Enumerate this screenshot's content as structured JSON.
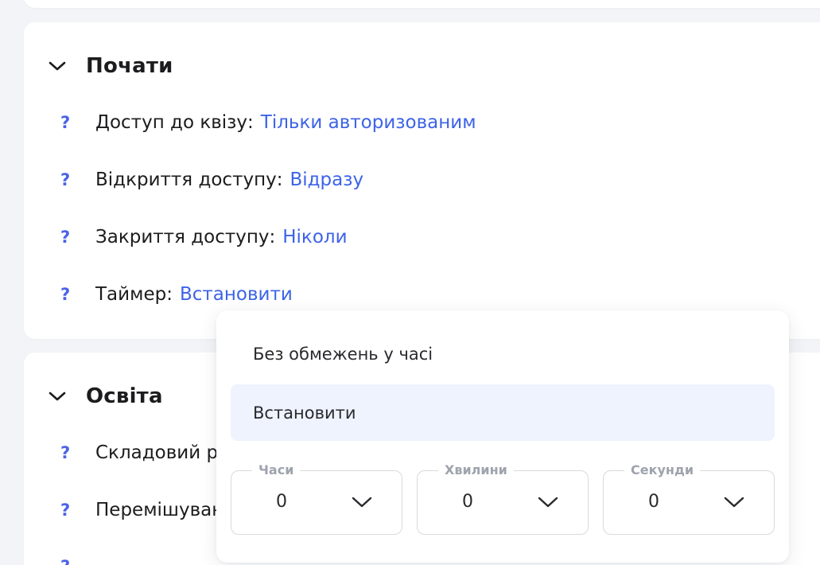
{
  "sections": {
    "start": {
      "title": "Почати",
      "rows": [
        {
          "label": "Доступ до квізу:",
          "value": "Тільки авторизованим"
        },
        {
          "label": "Відкриття доступу:",
          "value": "Відразу"
        },
        {
          "label": "Закриття доступу:",
          "value": "Ніколи"
        },
        {
          "label": "Таймер:",
          "value": "Встановити"
        }
      ]
    },
    "education": {
      "title": "Освіта",
      "rows": [
        {
          "label": "Складовий р"
        },
        {
          "label": "Перемішуван"
        }
      ]
    }
  },
  "help_symbol": "?",
  "timer_dropdown": {
    "options": [
      "Без обмежень у часі",
      "Встановити"
    ],
    "selected": "Встановити",
    "fields": [
      {
        "label": "Часи",
        "value": "0"
      },
      {
        "label": "Хвилини",
        "value": "0"
      },
      {
        "label": "Секунди",
        "value": "0"
      }
    ]
  },
  "colors": {
    "accent": "#3d63e8",
    "help": "#4a63e6",
    "selected_bg": "#eef3fd",
    "page_bg": "#f3f4f7"
  },
  "icons": {
    "section_toggle": "chevron-down-icon",
    "field_toggle": "chevron-down-icon"
  }
}
